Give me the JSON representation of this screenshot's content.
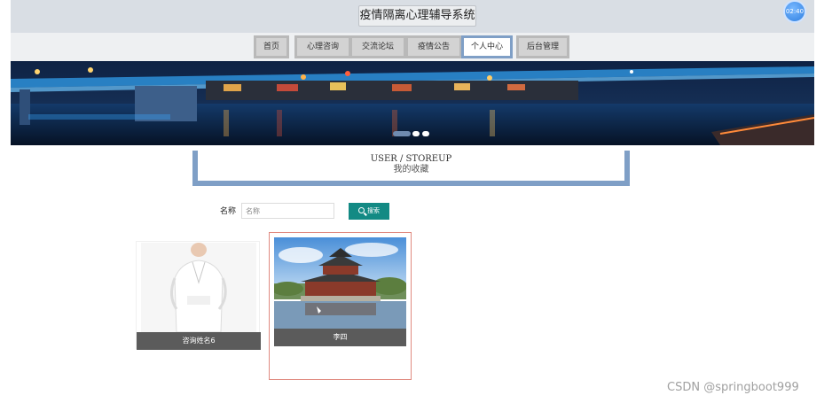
{
  "header": {
    "title": "疫情隔离心理辅导系统",
    "clock": "02:40"
  },
  "nav": {
    "items": [
      {
        "label": "首页"
      },
      {
        "label": "心理咨询"
      },
      {
        "label": "交流论坛"
      },
      {
        "label": "疫情公告"
      },
      {
        "label": "个人中心",
        "active": true
      },
      {
        "label": "后台管理"
      }
    ]
  },
  "section": {
    "title_en": "USER / STOREUP",
    "title_cn": "我的收藏"
  },
  "search": {
    "label": "名称",
    "placeholder": "名称",
    "value": "",
    "button_label": "搜索"
  },
  "cards": [
    {
      "name": "咨询姓名6"
    },
    {
      "name": "李四"
    }
  ],
  "watermark": "CSDN @springboot999",
  "colors": {
    "accent": "#7f9fc6",
    "search_button": "#138a84",
    "card_highlight": "#e08a80"
  }
}
